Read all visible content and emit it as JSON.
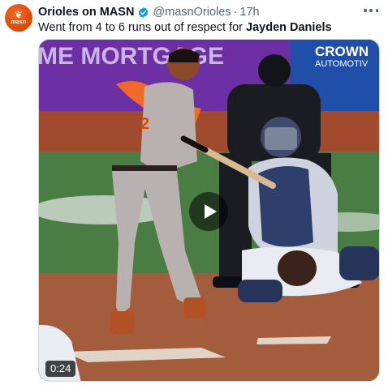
{
  "author": {
    "display_name": "Orioles on MASN",
    "handle": "@masnOrioles",
    "separator": "·",
    "timestamp": "17h",
    "avatar_text": "masn",
    "verified_color": "#1d9bf0"
  },
  "tweet": {
    "text_prefix": "Went from 4 to 6 runs out of respect for ",
    "text_bold": "Jayden Daniels"
  },
  "media": {
    "type": "video",
    "duration": "0:24",
    "banner_left_text": "ME MORTGAGE",
    "banner_right_text_1": "CROWN",
    "banner_right_text_2": "AUTOMOTIV",
    "batter_jersey_number": "2"
  },
  "icons": {
    "verified": "verified-badge-icon",
    "more": "more-options-icon",
    "play": "play-icon"
  },
  "colors": {
    "orioles_orange": "#df4601",
    "text_primary": "#0f1419",
    "text_secondary": "#536471"
  }
}
